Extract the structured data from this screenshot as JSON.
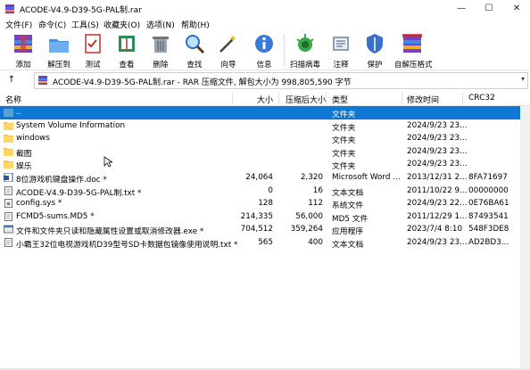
{
  "window": {
    "title": "ACODE-V4.9-D39-5G-PAL制.rar",
    "controls": [
      "—",
      "☐",
      "✕"
    ]
  },
  "menu": [
    "文件(F)",
    "命令(C)",
    "工具(S)",
    "收藏夹(O)",
    "选项(N)",
    "帮助(H)"
  ],
  "toolbar": [
    {
      "label": "添加",
      "icon": "add-archive-icon"
    },
    {
      "label": "解压到",
      "icon": "extract-to-icon"
    },
    {
      "label": "测试",
      "icon": "test-icon"
    },
    {
      "label": "查看",
      "icon": "view-icon"
    },
    {
      "label": "删除",
      "icon": "delete-icon"
    },
    {
      "label": "查找",
      "icon": "find-icon"
    },
    {
      "label": "向导",
      "icon": "wizard-icon"
    },
    {
      "label": "信息",
      "icon": "info-icon"
    },
    {
      "label": "扫描病毒",
      "icon": "virus-scan-icon"
    },
    {
      "label": "注释",
      "icon": "comment-icon"
    },
    {
      "label": "保护",
      "icon": "protect-icon"
    },
    {
      "label": "自解压格式",
      "icon": "sfx-icon"
    }
  ],
  "address": {
    "text": "ACODE-V4.9-D39-5G-PAL制.rar - RAR 压缩文件, 解包大小为 998,805,590 字节"
  },
  "columns": {
    "name": "名称",
    "size": "大小",
    "packed": "压缩后大小",
    "type": "类型",
    "modified": "修改时间",
    "crc": "CRC32"
  },
  "files": [
    {
      "name": "..",
      "size": "",
      "packed": "",
      "type": "文件夹",
      "modified": "",
      "crc": "",
      "kind": "folder",
      "selected": true
    },
    {
      "name": "System Volume Information",
      "size": "",
      "packed": "",
      "type": "文件夹",
      "modified": "2024/9/23 23...",
      "crc": "",
      "kind": "folder"
    },
    {
      "name": "windows",
      "size": "",
      "packed": "",
      "type": "文件夹",
      "modified": "2024/9/23 23...",
      "crc": "",
      "kind": "folder"
    },
    {
      "name": "截图",
      "size": "",
      "packed": "",
      "type": "文件夹",
      "modified": "2024/9/23 23...",
      "crc": "",
      "kind": "folder"
    },
    {
      "name": "娱乐",
      "size": "",
      "packed": "",
      "type": "文件夹",
      "modified": "2024/9/23 23...",
      "crc": "",
      "kind": "folder"
    },
    {
      "name": "8位游戏机键盘操作.doc *",
      "size": "24,064",
      "packed": "2,320",
      "type": "Microsoft Word ...",
      "modified": "2013/12/31 2...",
      "crc": "8FA71697",
      "kind": "doc"
    },
    {
      "name": "ACODE-V4.9-D39-5G-PAL制.txt *",
      "size": "0",
      "packed": "16",
      "type": "文本文档",
      "modified": "2011/10/22 9...",
      "crc": "00000000",
      "kind": "txt"
    },
    {
      "name": "config.sys *",
      "size": "128",
      "packed": "112",
      "type": "系统文件",
      "modified": "2024/9/23 22...",
      "crc": "0E76BA61",
      "kind": "sys"
    },
    {
      "name": "FCMD5-sums.MD5 *",
      "size": "214,335",
      "packed": "56,000",
      "type": "MD5 文件",
      "modified": "2011/12/29 1...",
      "crc": "87493541",
      "kind": "txt"
    },
    {
      "name": "文件和文件夹只读和隐藏属性设置或取消修改器.exe *",
      "size": "704,512",
      "packed": "359,264",
      "type": "应用程序",
      "modified": "2023/7/4 8:10",
      "crc": "548F3DE8",
      "kind": "exe"
    },
    {
      "name": "小霸王32位电视游戏机D39型号SD卡数据包镜像使用说明.txt *",
      "size": "565",
      "packed": "400",
      "type": "文本文档",
      "modified": "2024/9/23 23...",
      "crc": "AD2BD3...",
      "kind": "txt"
    }
  ],
  "colors": {
    "selection": "#0f78d7",
    "folder": "#f5c451"
  }
}
